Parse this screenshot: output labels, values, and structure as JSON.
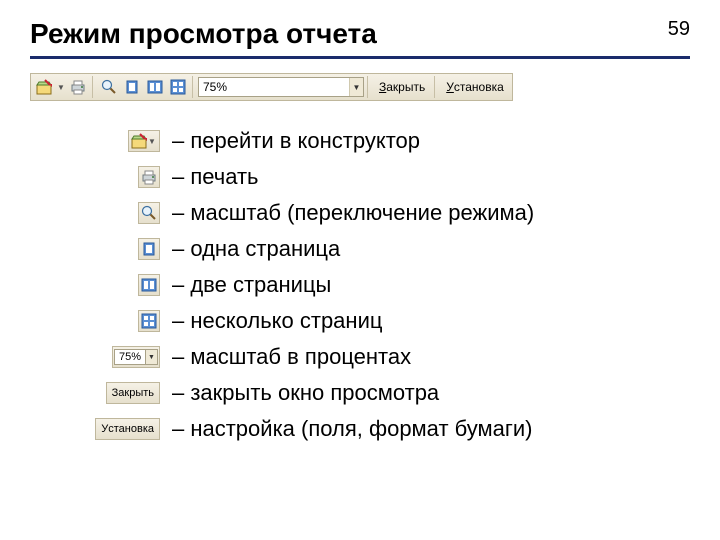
{
  "page_number": "59",
  "title": "Режим просмотра отчета",
  "toolbar": {
    "zoom": "75%",
    "zoom_width_main": "150",
    "close": {
      "full": "Закрыть",
      "hot": "З",
      "rest": "акрыть"
    },
    "setup": {
      "full": "Установка",
      "hot": "У",
      "rest": "становка"
    }
  },
  "legend": [
    {
      "icon": "design-view",
      "text": "– перейти в конструктор"
    },
    {
      "icon": "print",
      "text": "– печать"
    },
    {
      "icon": "zoom",
      "text": "– масштаб (переключение режима)"
    },
    {
      "icon": "one-page",
      "text": "– одна страница"
    },
    {
      "icon": "two-pages",
      "text": "– две страницы"
    },
    {
      "icon": "multi-pages",
      "text": "– несколько страниц"
    },
    {
      "icon": "zoom-percent",
      "text": "– масштаб в процентах",
      "value": "75%"
    },
    {
      "icon": "close-btn",
      "text": "– закрыть окно просмотра",
      "hot": "З",
      "rest": "акрыть"
    },
    {
      "icon": "setup-btn",
      "text": "– настройка (поля, формат бумаги)",
      "hot": "У",
      "rest": "становка"
    }
  ]
}
